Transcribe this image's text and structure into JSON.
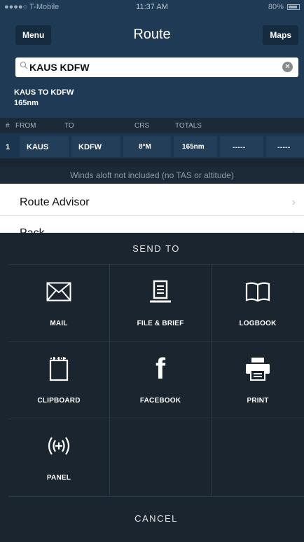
{
  "status_bar": {
    "carrier": "●●●●○ T-Mobile",
    "time": "11:37 AM",
    "battery": "80%"
  },
  "navbar": {
    "menu_label": "Menu",
    "title": "Route",
    "maps_label": "Maps"
  },
  "search": {
    "value": "KAUS KDFW"
  },
  "route_summary": {
    "route": "KAUS TO KDFW",
    "distance": "165nm"
  },
  "table": {
    "headers": [
      "#",
      "FROM",
      "TO",
      "CRS",
      "TOTALS"
    ],
    "rows": [
      {
        "num": "1",
        "from": "KAUS",
        "to": "KDFW",
        "crs": "8°M",
        "total": "165nm",
        "extra1": "-----",
        "extra2": "-----"
      }
    ]
  },
  "winds_note": "Winds aloft not included (no TAS or altitude)",
  "list": [
    {
      "label": "Route Advisor"
    },
    {
      "label": "Pack"
    }
  ],
  "send_to": {
    "title": "SEND TO",
    "items": [
      {
        "label": "MAIL",
        "icon": "mail-icon"
      },
      {
        "label": "FILE & BRIEF",
        "icon": "file-brief-icon"
      },
      {
        "label": "LOGBOOK",
        "icon": "logbook-icon"
      },
      {
        "label": "CLIPBOARD",
        "icon": "clipboard-icon"
      },
      {
        "label": "FACEBOOK",
        "icon": "facebook-icon"
      },
      {
        "label": "PRINT",
        "icon": "print-icon"
      },
      {
        "label": "PANEL",
        "icon": "panel-icon"
      }
    ],
    "cancel": "CANCEL"
  },
  "colors": {
    "nav_bg": "#1e3a55",
    "sheet_bg": "#1b2530"
  }
}
